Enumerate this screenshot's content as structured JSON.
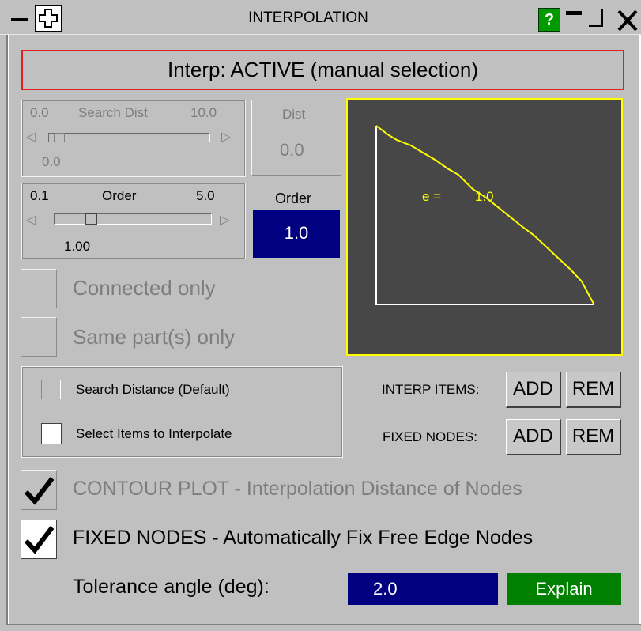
{
  "window": {
    "title": "INTERPOLATION",
    "help_label": "?",
    "minimize_icon": "minimize-icon",
    "maximize_icon": "maximize-icon",
    "close_icon": "close-icon",
    "menu_icon": "menu-dash-icon",
    "move_icon": "move-cross-icon"
  },
  "status": {
    "text": "Interp: ACTIVE (manual selection)",
    "border_color": "#e02020"
  },
  "search_dist": {
    "min_label": "0.0",
    "title": "Search Dist",
    "max_label": "10.0",
    "value_label": "0.0",
    "slider_fraction": 0.0,
    "box_title": "Dist",
    "box_value": "0.0"
  },
  "order": {
    "min_label": "0.1",
    "title": "Order",
    "max_label": "5.0",
    "value_label": "1.00",
    "slider_fraction": 0.2,
    "box_title": "Order",
    "box_value": "1.0",
    "box_color": "#000080"
  },
  "options": {
    "connected_only": "Connected only",
    "same_parts_only": "Same part(s) only"
  },
  "graph": {
    "label_prefix": "e =",
    "label_value": "1.0",
    "bg_color": "#474747",
    "line_color": "#ffff00",
    "border_color": "#ffff00"
  },
  "mode": {
    "search_distance": "Search Distance (Default)",
    "select_items": "Select Items to Interpolate"
  },
  "items": {
    "interp_label": "INTERP ITEMS:",
    "fixed_label": "FIXED NODES:",
    "add_label": "ADD",
    "rem_label": "REM"
  },
  "contour": {
    "label": "CONTOUR PLOT - Interpolation Distance of Nodes",
    "checked": true
  },
  "fixed_nodes": {
    "label": "FIXED NODES - Automatically Fix Free Edge Nodes",
    "checked": true
  },
  "tolerance": {
    "label": "Tolerance angle (deg):",
    "value": "2.0",
    "value_color": "#000080",
    "explain_label": "Explain",
    "explain_color": "#008000"
  }
}
